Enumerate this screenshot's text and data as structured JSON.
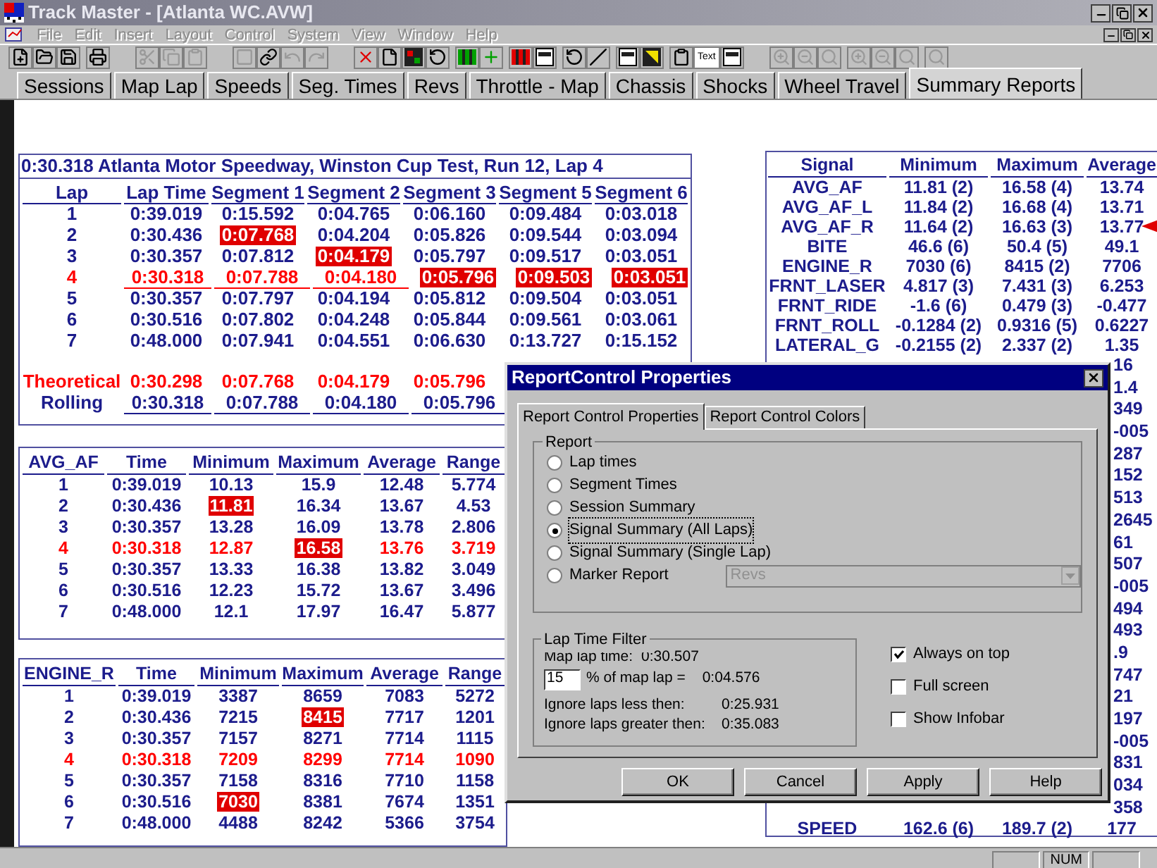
{
  "window": {
    "title": "Track Master - [Atlanta WC.AVW]"
  },
  "menu": [
    {
      "label": "File",
      "disabled": true
    },
    {
      "label": "Edit",
      "disabled": true
    },
    {
      "label": "Insert",
      "disabled": true
    },
    {
      "label": "Layout",
      "disabled": true
    },
    {
      "label": "Control",
      "disabled": true
    },
    {
      "label": "System",
      "disabled": true
    },
    {
      "label": "View",
      "disabled": true
    },
    {
      "label": "Window",
      "disabled": true
    },
    {
      "label": "Help",
      "disabled": true
    }
  ],
  "toolbar": {
    "text_button": "Text"
  },
  "tabs": [
    {
      "label": "Sessions",
      "selected": false
    },
    {
      "label": "Map Lap",
      "selected": false
    },
    {
      "label": "Speeds",
      "selected": false
    },
    {
      "label": "Seg. Times",
      "selected": false
    },
    {
      "label": "Revs",
      "selected": false
    },
    {
      "label": "Throttle - Map",
      "selected": false
    },
    {
      "label": "Chassis",
      "selected": false
    },
    {
      "label": "Shocks",
      "selected": false
    },
    {
      "label": "Wheel Travel",
      "selected": false
    },
    {
      "label": "Summary Reports",
      "selected": true
    }
  ],
  "lap_report": {
    "title": "0:30.318 Atlanta Motor Speedway, Winston Cup Test, Run 12, Lap 4",
    "columns": [
      "Lap",
      "Lap Time",
      "Segment 1",
      "Segment 2",
      "Segment 3",
      "Segment 5",
      "Segment 6"
    ],
    "rows": [
      {
        "cells": [
          "1",
          "0:39.019",
          "0:15.592",
          "0:04.765",
          "0:06.160",
          "0:09.484",
          "0:03.018"
        ],
        "best": false,
        "highlighted": [
          false,
          false,
          false,
          false,
          false,
          false,
          false
        ]
      },
      {
        "cells": [
          "2",
          "0:30.436",
          "0:07.768",
          "0:04.204",
          "0:05.826",
          "0:09.544",
          "0:03.094"
        ],
        "best": false,
        "highlighted": [
          false,
          false,
          true,
          false,
          false,
          false,
          false
        ]
      },
      {
        "cells": [
          "3",
          "0:30.357",
          "0:07.812",
          "0:04.179",
          "0:05.797",
          "0:09.517",
          "0:03.051"
        ],
        "best": false,
        "highlighted": [
          false,
          false,
          false,
          true,
          false,
          false,
          false
        ]
      },
      {
        "cells": [
          "4",
          "0:30.318",
          "0:07.788",
          "0:04.180",
          "0:05.796",
          "0:09.503",
          "0:03.051"
        ],
        "best": true,
        "highlighted": [
          false,
          false,
          false,
          false,
          true,
          true,
          true
        ]
      },
      {
        "cells": [
          "5",
          "0:30.357",
          "0:07.797",
          "0:04.194",
          "0:05.812",
          "0:09.504",
          "0:03.051"
        ],
        "best": false,
        "highlighted": [
          false,
          false,
          false,
          false,
          false,
          false,
          false
        ]
      },
      {
        "cells": [
          "6",
          "0:30.516",
          "0:07.802",
          "0:04.248",
          "0:05.844",
          "0:09.561",
          "0:03.061"
        ],
        "best": false,
        "highlighted": [
          false,
          false,
          false,
          false,
          false,
          false,
          false
        ]
      },
      {
        "cells": [
          "7",
          "0:48.000",
          "0:07.941",
          "0:04.551",
          "0:06.630",
          "0:13.727",
          "0:15.152"
        ],
        "best": false,
        "highlighted": [
          false,
          false,
          false,
          false,
          false,
          false,
          false
        ]
      }
    ],
    "totals": [
      {
        "kind": "theoretical",
        "cells": [
          "Theoretical",
          "0:30.298",
          "0:07.768",
          "0:04.179",
          "0:05.796"
        ]
      },
      {
        "kind": "rolling",
        "cells": [
          "Rolling",
          "0:30.318",
          "0:07.788",
          "0:04.180",
          "0:05.796"
        ]
      }
    ]
  },
  "signal_tables": [
    {
      "columns": [
        "AVG_AF",
        "Time",
        "Minimum",
        "Maximum",
        "Average",
        "Range"
      ],
      "rows": [
        {
          "cells": [
            "1",
            "0:39.019",
            "10.13",
            "15.9",
            "12.48",
            "5.774"
          ],
          "best": false,
          "highlighted": [
            false,
            false,
            false,
            false,
            false,
            false
          ]
        },
        {
          "cells": [
            "2",
            "0:30.436",
            "11.81",
            "16.34",
            "13.67",
            "4.53"
          ],
          "best": false,
          "highlighted": [
            false,
            false,
            true,
            false,
            false,
            false
          ]
        },
        {
          "cells": [
            "3",
            "0:30.357",
            "13.28",
            "16.09",
            "13.78",
            "2.806"
          ],
          "best": false,
          "highlighted": [
            false,
            false,
            false,
            false,
            false,
            false
          ]
        },
        {
          "cells": [
            "4",
            "0:30.318",
            "12.87",
            "16.58",
            "13.76",
            "3.719"
          ],
          "best": true,
          "highlighted": [
            false,
            false,
            false,
            true,
            false,
            false
          ]
        },
        {
          "cells": [
            "5",
            "0:30.357",
            "13.33",
            "16.38",
            "13.82",
            "3.049"
          ],
          "best": false,
          "highlighted": [
            false,
            false,
            false,
            false,
            false,
            false
          ]
        },
        {
          "cells": [
            "6",
            "0:30.516",
            "12.23",
            "15.72",
            "13.67",
            "3.496"
          ],
          "best": false,
          "highlighted": [
            false,
            false,
            false,
            false,
            false,
            false
          ]
        },
        {
          "cells": [
            "7",
            "0:48.000",
            "12.1",
            "17.97",
            "16.47",
            "5.877"
          ],
          "best": false,
          "highlighted": [
            false,
            false,
            false,
            false,
            false,
            false
          ]
        }
      ]
    },
    {
      "columns": [
        "ENGINE_R",
        "Time",
        "Minimum",
        "Maximum",
        "Average",
        "Range"
      ],
      "rows": [
        {
          "cells": [
            "1",
            "0:39.019",
            "3387",
            "8659",
            "7083",
            "5272"
          ],
          "best": false,
          "highlighted": [
            false,
            false,
            false,
            false,
            false,
            false
          ]
        },
        {
          "cells": [
            "2",
            "0:30.436",
            "7215",
            "8415",
            "7717",
            "1201"
          ],
          "best": false,
          "highlighted": [
            false,
            false,
            false,
            true,
            false,
            false
          ]
        },
        {
          "cells": [
            "3",
            "0:30.357",
            "7157",
            "8271",
            "7714",
            "1115"
          ],
          "best": false,
          "highlighted": [
            false,
            false,
            false,
            false,
            false,
            false
          ]
        },
        {
          "cells": [
            "4",
            "0:30.318",
            "7209",
            "8299",
            "7714",
            "1090"
          ],
          "best": true,
          "highlighted": [
            false,
            false,
            false,
            false,
            false,
            false
          ]
        },
        {
          "cells": [
            "5",
            "0:30.357",
            "7158",
            "8316",
            "7710",
            "1158"
          ],
          "best": false,
          "highlighted": [
            false,
            false,
            false,
            false,
            false,
            false
          ]
        },
        {
          "cells": [
            "6",
            "0:30.516",
            "7030",
            "8381",
            "7674",
            "1351"
          ],
          "best": false,
          "highlighted": [
            false,
            false,
            true,
            false,
            false,
            false
          ]
        },
        {
          "cells": [
            "7",
            "0:48.000",
            "4488",
            "8242",
            "5366",
            "3754"
          ],
          "best": false,
          "highlighted": [
            false,
            false,
            false,
            false,
            false,
            false
          ]
        }
      ]
    }
  ],
  "signal_summary": {
    "columns": [
      "Signal",
      "Minimum",
      "Maximum",
      "Average"
    ],
    "rows": [
      {
        "kind": "full",
        "cells": [
          "AVG_AF",
          "11.81 (2)",
          "16.58 (4)",
          "13.74"
        ],
        "pointer": false
      },
      {
        "kind": "full",
        "cells": [
          "AVG_AF_L",
          "11.84 (2)",
          "16.68 (4)",
          "13.71"
        ],
        "pointer": false
      },
      {
        "kind": "full",
        "cells": [
          "AVG_AF_R",
          "11.64 (2)",
          "16.63 (3)",
          "13.77"
        ],
        "pointer": true
      },
      {
        "kind": "full",
        "cells": [
          "BITE",
          "46.6 (6)",
          "50.4 (5)",
          "49.1"
        ],
        "pointer": false
      },
      {
        "kind": "full",
        "cells": [
          "ENGINE_R",
          "7030 (6)",
          "8415 (2)",
          "7706"
        ],
        "pointer": false
      },
      {
        "kind": "full",
        "cells": [
          "FRNT_LASER",
          "4.817 (3)",
          "7.431 (3)",
          "6.253"
        ],
        "pointer": false
      },
      {
        "kind": "full",
        "cells": [
          "FRNT_RIDE",
          "-1.6 (6)",
          "0.479 (3)",
          "-0.477"
        ],
        "pointer": false
      },
      {
        "kind": "full",
        "cells": [
          "FRNT_ROLL",
          "-0.1284 (2)",
          "0.9316 (5)",
          "0.6227"
        ],
        "pointer": false
      },
      {
        "kind": "full",
        "cells": [
          "LATERAL_G",
          "-0.2155 (2)",
          "2.337 (2)",
          "1.35"
        ],
        "pointer": false
      },
      {
        "kind": "partial",
        "fragment": "16"
      },
      {
        "kind": "partial",
        "fragment": "1.4"
      },
      {
        "kind": "partial",
        "fragment": "349"
      },
      {
        "kind": "partial",
        "fragment": "-005"
      },
      {
        "kind": "partial",
        "fragment": "287"
      },
      {
        "kind": "partial",
        "fragment": "152"
      },
      {
        "kind": "partial",
        "fragment": "513"
      },
      {
        "kind": "partial",
        "fragment": "2645"
      },
      {
        "kind": "partial",
        "fragment": "61"
      },
      {
        "kind": "partial",
        "fragment": "507"
      },
      {
        "kind": "partial",
        "fragment": "-005"
      },
      {
        "kind": "partial",
        "fragment": "494"
      },
      {
        "kind": "partial",
        "fragment": "493"
      },
      {
        "kind": "partial",
        "fragment": ".9"
      },
      {
        "kind": "partial",
        "fragment": "747"
      },
      {
        "kind": "partial",
        "fragment": "21"
      },
      {
        "kind": "partial",
        "fragment": "197"
      },
      {
        "kind": "partial",
        "fragment": "-005"
      },
      {
        "kind": "partial",
        "fragment": "831"
      },
      {
        "kind": "partial",
        "fragment": "034"
      },
      {
        "kind": "partial",
        "fragment": "358"
      },
      {
        "kind": "full",
        "cells": [
          "SPEED",
          "162.6 (6)",
          "189.7 (2)",
          "177"
        ],
        "pointer": false
      }
    ]
  },
  "dialog": {
    "title": "ReportControl Properties",
    "tabs": [
      {
        "label": "Report Control Properties",
        "selected": true
      },
      {
        "label": "Report Control Colors",
        "selected": false
      }
    ],
    "report_group": {
      "title": "Report",
      "options": [
        {
          "label": "Lap times",
          "selected": false
        },
        {
          "label": "Segment Times",
          "selected": false
        },
        {
          "label": "Session Summary",
          "selected": false
        },
        {
          "label": "Signal Summary (All Laps)",
          "selected": true
        },
        {
          "label": "Signal Summary (Single Lap)",
          "selected": false
        },
        {
          "label": "Marker Report",
          "selected": false
        }
      ],
      "marker_select": {
        "value": "Revs",
        "disabled": true
      }
    },
    "lap_time_filter": {
      "title": "Lap Time Filter",
      "map_lap_label": "Map lap time:",
      "map_lap_value": "0:30.507",
      "percent_value": "15",
      "percent_label": "% of map lap =",
      "percent_result": "0:04.576",
      "ignore_less_label": "Ignore laps less then:",
      "ignore_less_value": "0:25.931",
      "ignore_greater_label": "Ignore laps greater then:",
      "ignore_greater_value": "0:35.083"
    },
    "checkboxes": [
      {
        "label": "Always on top",
        "checked": true
      },
      {
        "label": "Full screen",
        "checked": false
      },
      {
        "label": "Show Infobar",
        "checked": false
      }
    ],
    "buttons": [
      {
        "label": "OK"
      },
      {
        "label": "Cancel"
      },
      {
        "label": "Apply"
      },
      {
        "label": "Help"
      }
    ]
  },
  "status_bar": {
    "num": "NUM"
  }
}
